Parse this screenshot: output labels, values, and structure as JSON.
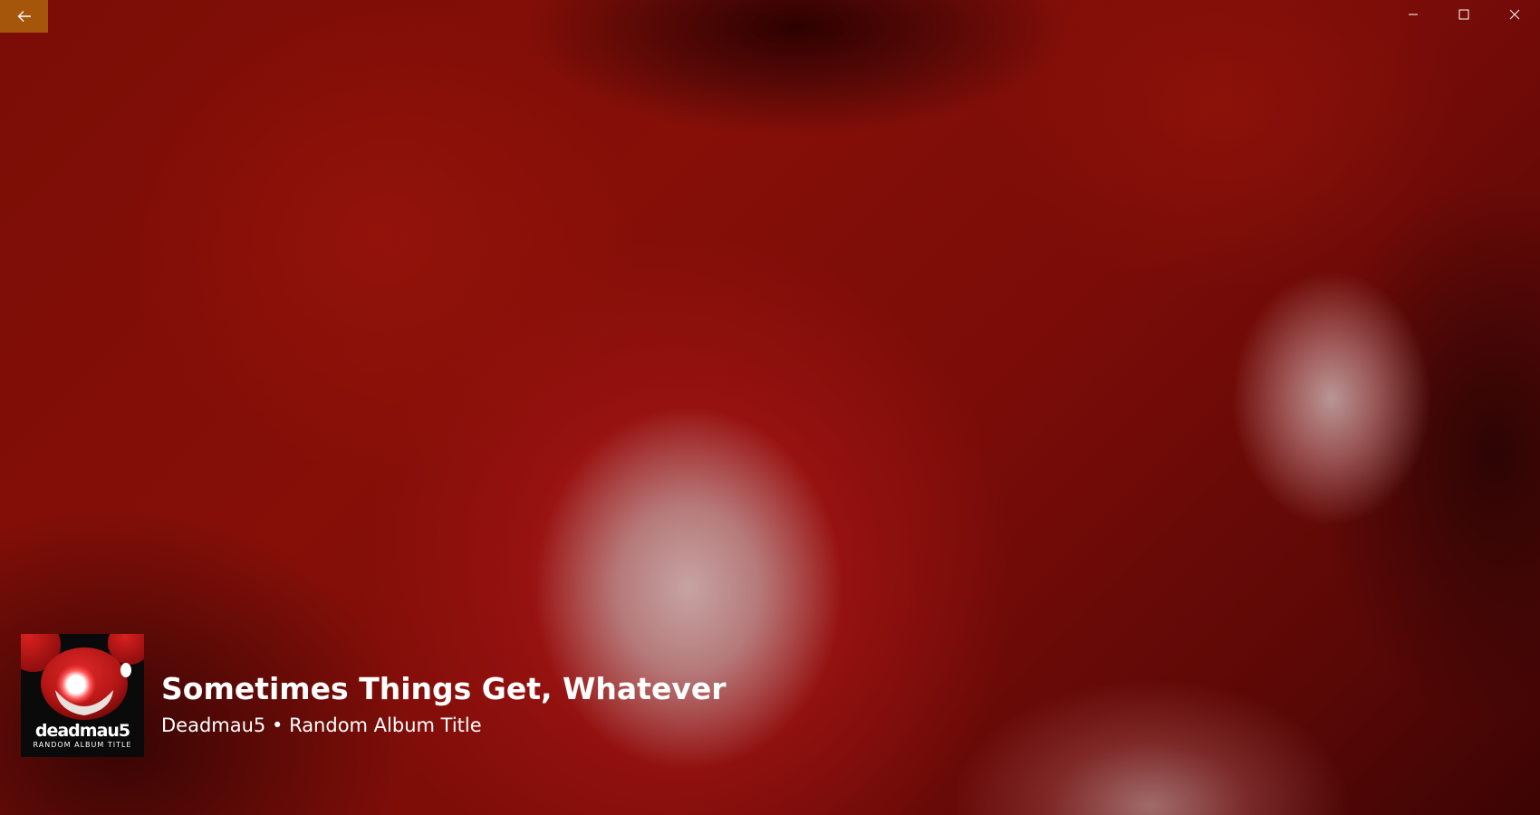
{
  "window": {
    "back_icon": "arrow-left-icon",
    "accent_color": "#a6560b",
    "caption_icons": [
      "minimize-icon",
      "maximize-icon",
      "close-icon"
    ]
  },
  "album": {
    "brand": "deadmau5",
    "subtitle": "RANDOM ALBUM TITLE"
  },
  "track": {
    "title": "Sometimes Things Get, Whatever",
    "artist": "Deadmau5",
    "separator": "•",
    "album": "Random Album Title"
  }
}
